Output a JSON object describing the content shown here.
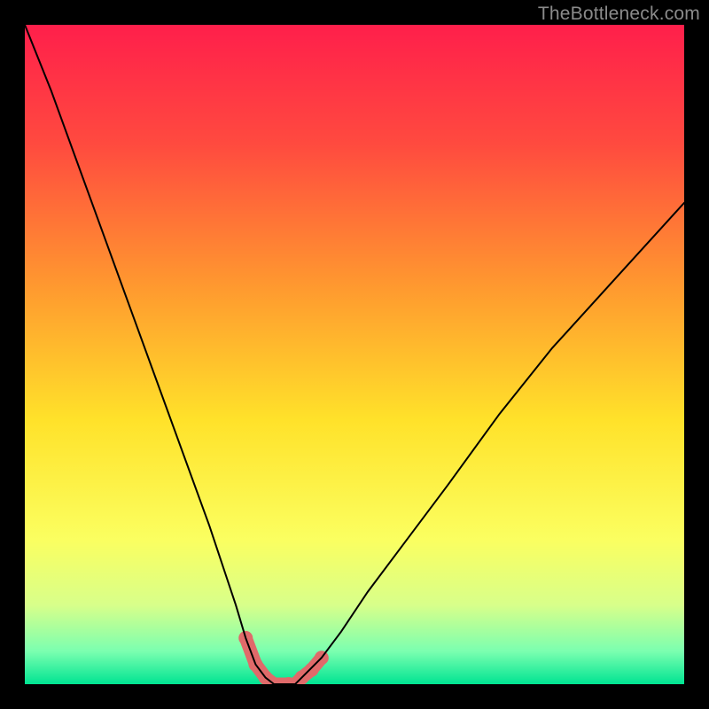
{
  "watermark": "TheBottleneck.com",
  "chart_data": {
    "type": "line",
    "title": "",
    "xlabel": "",
    "ylabel": "",
    "xlim": [
      0,
      100
    ],
    "ylim": [
      0,
      100
    ],
    "background_gradient_stops": [
      {
        "pct": 0,
        "color": "#ff1f4b"
      },
      {
        "pct": 18,
        "color": "#ff4a3f"
      },
      {
        "pct": 40,
        "color": "#ff9a2f"
      },
      {
        "pct": 60,
        "color": "#ffe22a"
      },
      {
        "pct": 78,
        "color": "#fbff60"
      },
      {
        "pct": 88,
        "color": "#d8ff8a"
      },
      {
        "pct": 95,
        "color": "#7bffb0"
      },
      {
        "pct": 100,
        "color": "#00e492"
      }
    ],
    "series": [
      {
        "name": "bottleneck-curve",
        "color": "#000000",
        "stroke_width": 2,
        "x": [
          0,
          4,
          8,
          12,
          16,
          20,
          24,
          28,
          30,
          32,
          33.5,
          35,
          36.5,
          37.8,
          39,
          40,
          41,
          42,
          45,
          48,
          52,
          58,
          64,
          72,
          80,
          90,
          100
        ],
        "y": [
          100,
          90,
          79,
          68,
          57,
          46,
          35,
          24,
          18,
          12,
          7,
          3,
          1,
          0,
          0,
          0,
          0,
          1,
          4,
          8,
          14,
          22,
          30,
          41,
          51,
          62,
          73
        ]
      },
      {
        "name": "valley-highlight",
        "color": "#e06a6a",
        "stroke_width": 15,
        "x": [
          33.5,
          35,
          36.5,
          37.8,
          39,
          40,
          41,
          42,
          43.5,
          45
        ],
        "y": [
          7,
          3,
          1,
          0,
          0,
          0,
          0,
          1,
          2.2,
          4
        ]
      }
    ],
    "markers": {
      "name": "valley-dots",
      "color": "#e06a6a",
      "radius": 8,
      "x": [
        33.5,
        35,
        36.5,
        40,
        42,
        43.5,
        45
      ],
      "y": [
        7,
        3,
        1,
        0,
        1,
        2.2,
        4
      ]
    }
  }
}
